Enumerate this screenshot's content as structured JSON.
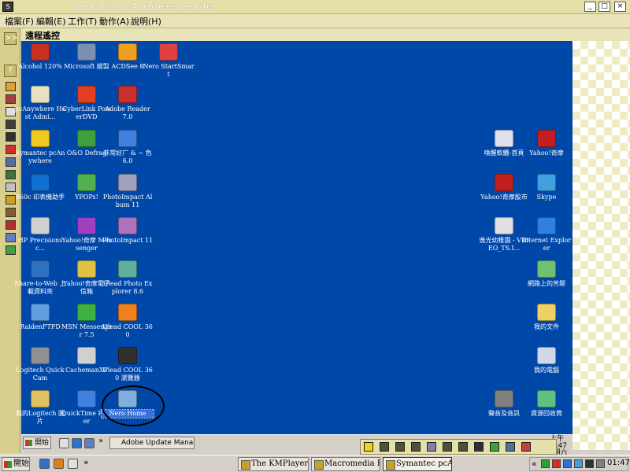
{
  "window": {
    "title": "Symantec pcAnywhere Remote",
    "min": "_",
    "max": "□",
    "close": "×"
  },
  "menu": [
    "檔案(F)",
    "編輯(E)",
    "工作(T)",
    "動作(A)",
    "說明(H)"
  ],
  "panel": {
    "title": "遠程遙控"
  },
  "left_strip": {
    "collapse": ">>",
    "help": "?"
  },
  "desktop_icons": [
    {
      "label": "Alcohol 120%",
      "color": "#c83020"
    },
    {
      "label": "Microsoft 繪製",
      "color": "#7b8fb0"
    },
    {
      "label": "ACDSee 8",
      "color": "#f0a020"
    },
    {
      "label": "Nero StartSmart",
      "color": "#e04040"
    },
    {
      "label": "pcAnywhere Host Admi...",
      "color": "#e8e0c0"
    },
    {
      "label": "CyberLink PowerDVD",
      "color": "#e04020"
    },
    {
      "label": "Adobe Reader 7.0",
      "color": "#c83030"
    },
    {
      "label": "Symantec pcAnywhere",
      "color": "#f0c820"
    },
    {
      "label": "O&O Defrag",
      "color": "#40a040"
    },
    {
      "label": "非常好厂 & ~ 色6.0",
      "color": "#4080e0"
    },
    {
      "label": "960c 印表機助手",
      "color": "#1070d0"
    },
    {
      "label": "YPOPs!",
      "color": "#50b050"
    },
    {
      "label": "PhotoImpact Album 11",
      "color": "#a0a0c0"
    },
    {
      "label": "HP Precisionsc...",
      "color": "#d0d0d0"
    },
    {
      "label": "Yahoo!奇摩 Messenger",
      "color": "#a040c0"
    },
    {
      "label": "PhotoImpact 11",
      "color": "#b070c0"
    },
    {
      "label": "Share-to-Web 上載資料夾",
      "color": "#3070c0"
    },
    {
      "label": "Yahoo!奇摩電子信箱",
      "color": "#e0c040"
    },
    {
      "label": "Ulead Photo Explorer 8.6",
      "color": "#60b0a0"
    },
    {
      "label": "RaidenFTPD",
      "color": "#60a0e0"
    },
    {
      "label": "MSN Messenger 7.5",
      "color": "#40b040"
    },
    {
      "label": "Ulead COOL 360",
      "color": "#f08020"
    },
    {
      "label": "Logitech QuickCam",
      "color": "#909090"
    },
    {
      "label": "CachemanXP",
      "color": "#d0d0d0"
    },
    {
      "label": "Ulead COOL 360 瀏覽器",
      "color": "#303030"
    },
    {
      "label": "我的Logitech 圖片",
      "color": "#e0c060"
    },
    {
      "label": "QuickTime Player",
      "color": "#4080e0"
    },
    {
      "label": "Nero Home",
      "color": "#80b0e0"
    },
    {
      "label": "喚醒軟體-首頁",
      "color": "#e0e0f0"
    },
    {
      "label": "Yahoo!奇摩",
      "color": "#c02020"
    },
    {
      "label": "Yahoo!奇摩股市",
      "color": "#c02020"
    },
    {
      "label": "Skype",
      "color": "#40a0e0"
    },
    {
      "label": "逸光幼稚園 - VIDEO_TS.I...",
      "color": "#e0e0e0"
    },
    {
      "label": "Internet Explorer",
      "color": "#3080e0"
    },
    {
      "label": "網路上的芳鄰",
      "color": "#70c070"
    },
    {
      "label": "我的文件",
      "color": "#f0d060"
    },
    {
      "label": "我的電腦",
      "color": "#d0d8e8"
    },
    {
      "label": "聲音及音訊",
      "color": "#808080"
    },
    {
      "label": "資源回收筒",
      "color": "#60c080"
    }
  ],
  "remote_taskbar": {
    "start": "開始",
    "more": "»",
    "task": "Adobe Update Manager",
    "time": "上午 01:47",
    "day": "星期六"
  },
  "taskbar": {
    "start": "開始",
    "more": "»",
    "tasks": [
      "The KMPlayer",
      "Macromedia Fir...",
      "Symantec pcAn..."
    ],
    "tray_more": "«",
    "time": "01:47"
  }
}
